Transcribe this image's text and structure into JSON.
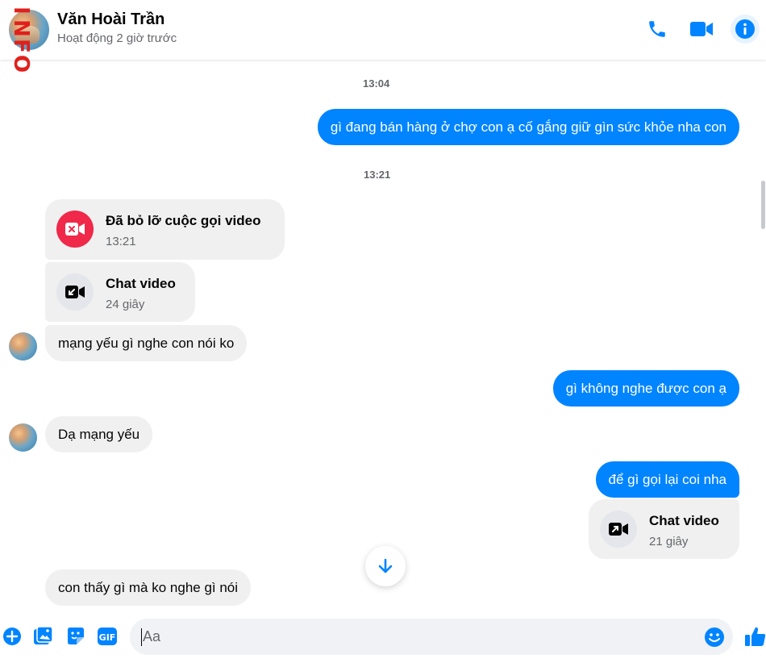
{
  "header": {
    "name": "Văn Hoài Trần",
    "status": "Hoạt động 2 giờ trước",
    "watermark": "INFO",
    "icons": [
      "phone-icon",
      "video-camera-icon",
      "info-icon"
    ]
  },
  "colors": {
    "accent": "#0084ff",
    "bubble_in": "#f0f0f0",
    "missed_call": "#f02849"
  },
  "messages": {
    "time1": "13:04",
    "out1": "gì đang bán hàng ở chợ con ạ cố gắng giữ gìn sức khỏe nha con",
    "time2": "13:21",
    "missed_call": {
      "title": "Đã bỏ lỡ cuộc gọi video",
      "sub": "13:21"
    },
    "video_call_in": {
      "title": "Chat video",
      "sub": "24 giây"
    },
    "in1": "mạng yếu gì nghe con nói ko",
    "out2": "gì không nghe được con ạ",
    "in2": "Dạ mạng yếu",
    "out3": "để gì gọi lại coi nha",
    "video_call_out": {
      "title": "Chat video",
      "sub": "21 giây"
    },
    "in3": "con thấy gì mà ko nghe gì nói"
  },
  "composer": {
    "placeholder": "Aa",
    "icons": [
      "plus-icon",
      "image-icon",
      "sticker-icon",
      "gif-icon",
      "emoji-icon",
      "like-icon"
    ],
    "gif_label": "GIF"
  }
}
